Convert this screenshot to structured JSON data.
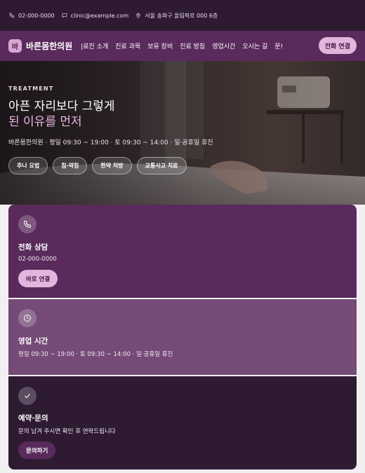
{
  "topbar": {
    "phone": "02-000-0000",
    "email": "clinic@example.com",
    "address": "서울 송파구 올림픽로 000 6층",
    "icons": [
      "phone-icon",
      "chat-icon",
      "location-pin-icon"
    ]
  },
  "nav": {
    "logo_char": "바",
    "brand": "바른몸한의원",
    "menu": [
      "|료진 소개",
      "진료 과목",
      "보유 장비",
      "진료 방침",
      "영업시간",
      "오시는 길",
      "문!"
    ],
    "cta": "전화 연결"
  },
  "hero": {
    "eyebrow": "TREATMENT",
    "title_line1": "아픈 자리보다 그렇게",
    "title_line2": "된 이유를 먼저",
    "subtitle": "바른몸한의원 · 평일 09:30 ~ 19:00 · 토 09:30 ~ 14:00 · 일·공휴일 휴진",
    "chips": [
      "추나 요법",
      "침·약침",
      "한약 처방",
      "교통사고 치료"
    ]
  },
  "cards": [
    {
      "icon": "phone-icon",
      "title": "전화 상담",
      "text": "02-000-0000",
      "button": "바로 연결"
    },
    {
      "icon": "clock-icon",
      "title": "영업 시간",
      "text": "평일 09:30 ~ 19:00 · 토 09:30 ~ 14:00 · 일·공휴일 휴진"
    },
    {
      "icon": "check-icon",
      "title": "예약·문의",
      "text": "문의 남겨 주시면 확인 후 연락드립니다",
      "button": "문의하기"
    }
  ],
  "colors": {
    "topbar_bg": "#2e1b32",
    "brand_purple": "#5a2a5c",
    "mid_purple": "#754a77",
    "accent_pink": "#e3b4dc"
  }
}
